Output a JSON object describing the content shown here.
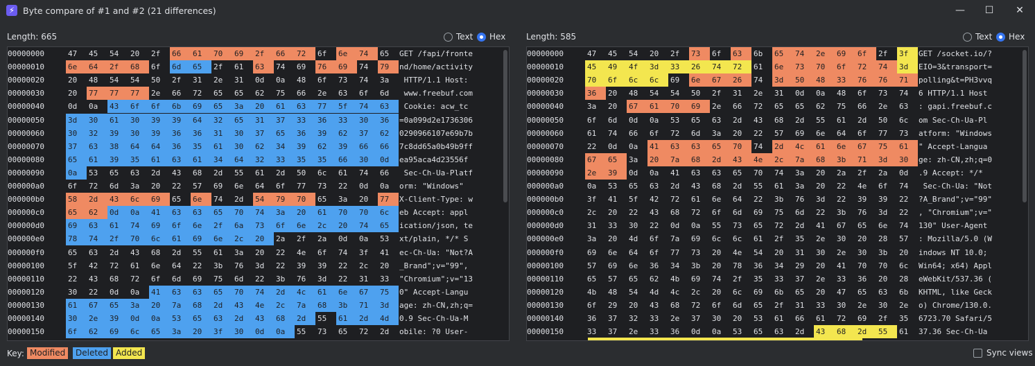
{
  "title": "Byte compare of #1 and #2  (21 differences)",
  "window_controls": {
    "minimize": "—",
    "maximize": "☐",
    "close": "✕"
  },
  "left": {
    "length_label": "Length: 665",
    "mode_text": "Text",
    "mode_hex": "Hex",
    "rows": [
      {
        "off": "00000000",
        "bytes": [
          "47",
          "45",
          "54",
          "20",
          "2f",
          "66",
          "61",
          "70",
          "69",
          "2f",
          "66",
          "72",
          "6f",
          "6e",
          "74",
          "65"
        ],
        "marks": "_____mmmmmmm_mm_",
        "ascii": "GET /fapi/fronte"
      },
      {
        "off": "00000010",
        "bytes": [
          "6e",
          "64",
          "2f",
          "68",
          "6f",
          "6d",
          "65",
          "2f",
          "61",
          "63",
          "74",
          "69",
          "76",
          "69",
          "74",
          "79"
        ],
        "marks": "mmmm_dd__m__mm_m",
        "ascii": "nd/home/activity"
      },
      {
        "off": "00000020",
        "bytes": [
          "20",
          "48",
          "54",
          "54",
          "50",
          "2f",
          "31",
          "2e",
          "31",
          "0d",
          "0a",
          "48",
          "6f",
          "73",
          "74",
          "3a"
        ],
        "marks": "________________",
        "ascii": " HTTP/1.1 Host:"
      },
      {
        "off": "00000030",
        "bytes": [
          "20",
          "77",
          "77",
          "77",
          "2e",
          "66",
          "72",
          "65",
          "65",
          "62",
          "75",
          "66",
          "2e",
          "63",
          "6f",
          "6d"
        ],
        "marks": "_mmm____________",
        "ascii": " www.freebuf.com"
      },
      {
        "off": "00000040",
        "bytes": [
          "0d",
          "0a",
          "43",
          "6f",
          "6f",
          "6b",
          "69",
          "65",
          "3a",
          "20",
          "61",
          "63",
          "77",
          "5f",
          "74",
          "63"
        ],
        "marks": "__dddddddddddddd",
        "ascii": " Cookie: acw_tc"
      },
      {
        "off": "00000050",
        "bytes": [
          "3d",
          "30",
          "61",
          "30",
          "39",
          "39",
          "64",
          "32",
          "65",
          "31",
          "37",
          "33",
          "36",
          "33",
          "30",
          "36"
        ],
        "marks": "dddddddddddddddd",
        "ascii": "=0a099d2e1736306"
      },
      {
        "off": "00000060",
        "bytes": [
          "30",
          "32",
          "39",
          "30",
          "39",
          "36",
          "36",
          "31",
          "30",
          "37",
          "65",
          "36",
          "39",
          "62",
          "37",
          "62"
        ],
        "marks": "dddddddddddddddd",
        "ascii": "0290966107e69b7b"
      },
      {
        "off": "00000070",
        "bytes": [
          "37",
          "63",
          "38",
          "64",
          "64",
          "36",
          "35",
          "61",
          "30",
          "62",
          "34",
          "39",
          "62",
          "39",
          "66",
          "66"
        ],
        "marks": "dddddddddddddddd",
        "ascii": "7c8dd65a0b49b9ff"
      },
      {
        "off": "00000080",
        "bytes": [
          "65",
          "61",
          "39",
          "35",
          "61",
          "63",
          "61",
          "34",
          "64",
          "32",
          "33",
          "35",
          "35",
          "66",
          "30",
          "0d"
        ],
        "marks": "dddddddddddddddd",
        "ascii": "ea95aca4d23556f"
      },
      {
        "off": "00000090",
        "bytes": [
          "0a",
          "53",
          "65",
          "63",
          "2d",
          "43",
          "68",
          "2d",
          "55",
          "61",
          "2d",
          "50",
          "6c",
          "61",
          "74",
          "66"
        ],
        "marks": "d_______________",
        "ascii": " Sec-Ch-Ua-Platf"
      },
      {
        "off": "000000a0",
        "bytes": [
          "6f",
          "72",
          "6d",
          "3a",
          "20",
          "22",
          "57",
          "69",
          "6e",
          "64",
          "6f",
          "77",
          "73",
          "22",
          "0d",
          "0a"
        ],
        "marks": "________________",
        "ascii": "orm: \"Windows\""
      },
      {
        "off": "000000b0",
        "bytes": [
          "58",
          "2d",
          "43",
          "6c",
          "69",
          "65",
          "6e",
          "74",
          "2d",
          "54",
          "79",
          "70",
          "65",
          "3a",
          "20",
          "77"
        ],
        "marks": "mmmmm_m__mmm___m",
        "ascii": "X-Client-Type: w"
      },
      {
        "off": "000000c0",
        "bytes": [
          "65",
          "62",
          "0d",
          "0a",
          "41",
          "63",
          "63",
          "65",
          "70",
          "74",
          "3a",
          "20",
          "61",
          "70",
          "70",
          "6c"
        ],
        "marks": "mmdddddddddddddd",
        "ascii": "eb Accept: appl"
      },
      {
        "off": "000000d0",
        "bytes": [
          "69",
          "63",
          "61",
          "74",
          "69",
          "6f",
          "6e",
          "2f",
          "6a",
          "73",
          "6f",
          "6e",
          "2c",
          "20",
          "74",
          "65"
        ],
        "marks": "dddddddddddddddd",
        "ascii": "ication/json, te"
      },
      {
        "off": "000000e0",
        "bytes": [
          "78",
          "74",
          "2f",
          "70",
          "6c",
          "61",
          "69",
          "6e",
          "2c",
          "20",
          "2a",
          "2f",
          "2a",
          "0d",
          "0a",
          "53"
        ],
        "marks": "dddddddddd______",
        "ascii": "xt/plain, */* S"
      },
      {
        "off": "000000f0",
        "bytes": [
          "65",
          "63",
          "2d",
          "43",
          "68",
          "2d",
          "55",
          "61",
          "3a",
          "20",
          "22",
          "4e",
          "6f",
          "74",
          "3f",
          "41"
        ],
        "marks": "________________",
        "ascii": "ec-Ch-Ua: \"Not?A"
      },
      {
        "off": "00000100",
        "bytes": [
          "5f",
          "42",
          "72",
          "61",
          "6e",
          "64",
          "22",
          "3b",
          "76",
          "3d",
          "22",
          "39",
          "39",
          "22",
          "2c",
          "20"
        ],
        "marks": "________________",
        "ascii": "_Brand\";v=\"99\","
      },
      {
        "off": "00000110",
        "bytes": [
          "22",
          "43",
          "68",
          "72",
          "6f",
          "6d",
          "69",
          "75",
          "6d",
          "22",
          "3b",
          "76",
          "3d",
          "22",
          "31",
          "33"
        ],
        "marks": "________________",
        "ascii": "\"Chromium\";v=\"13"
      },
      {
        "off": "00000120",
        "bytes": [
          "30",
          "22",
          "0d",
          "0a",
          "41",
          "63",
          "63",
          "65",
          "70",
          "74",
          "2d",
          "4c",
          "61",
          "6e",
          "67",
          "75"
        ],
        "marks": "____dddddddddddd",
        "ascii": "0\" Accept-Langu"
      },
      {
        "off": "00000130",
        "bytes": [
          "61",
          "67",
          "65",
          "3a",
          "20",
          "7a",
          "68",
          "2d",
          "43",
          "4e",
          "2c",
          "7a",
          "68",
          "3b",
          "71",
          "3d"
        ],
        "marks": "dddddddddddddddd",
        "ascii": "age: zh-CN,zh;q="
      },
      {
        "off": "00000140",
        "bytes": [
          "30",
          "2e",
          "39",
          "0d",
          "0a",
          "53",
          "65",
          "63",
          "2d",
          "43",
          "68",
          "2d",
          "55",
          "61",
          "2d",
          "4d"
        ],
        "marks": "dddddddddddd_ddd",
        "ascii": "0.9 Sec-Ch-Ua-M"
      },
      {
        "off": "00000150",
        "bytes": [
          "6f",
          "62",
          "69",
          "6c",
          "65",
          "3a",
          "20",
          "3f",
          "30",
          "0d",
          "0a",
          "55",
          "73",
          "65",
          "72",
          "2d"
        ],
        "marks": "ddddddddddd_____",
        "ascii": "obile: ?0 User-"
      }
    ]
  },
  "right": {
    "length_label": "Length: 585",
    "mode_text": "Text",
    "mode_hex": "Hex",
    "rows": [
      {
        "off": "00000000",
        "bytes": [
          "47",
          "45",
          "54",
          "20",
          "2f",
          "73",
          "6f",
          "63",
          "6b",
          "65",
          "74",
          "2e",
          "69",
          "6f",
          "2f",
          "3f"
        ],
        "marks": "_____m_m_mmmmm_a",
        "ascii": "GET /socket.io/?"
      },
      {
        "off": "00000010",
        "bytes": [
          "45",
          "49",
          "4f",
          "3d",
          "33",
          "26",
          "74",
          "72",
          "61",
          "6e",
          "73",
          "70",
          "6f",
          "72",
          "74",
          "3d"
        ],
        "marks": "aaaaaaaa_mmmmmma",
        "ascii": "EIO=3&transport="
      },
      {
        "off": "00000020",
        "bytes": [
          "70",
          "6f",
          "6c",
          "6c",
          "69",
          "6e",
          "67",
          "26",
          "74",
          "3d",
          "50",
          "48",
          "33",
          "76",
          "76",
          "71"
        ],
        "marks": "aaaa_mmm_mmmmmmm",
        "ascii": "polling&t=PH3vvq"
      },
      {
        "off": "00000030",
        "bytes": [
          "36",
          "20",
          "48",
          "54",
          "54",
          "50",
          "2f",
          "31",
          "2e",
          "31",
          "0d",
          "0a",
          "48",
          "6f",
          "73",
          "74"
        ],
        "marks": "m_______________",
        "ascii": "6 HTTP/1.1 Host"
      },
      {
        "off": "00000040",
        "bytes": [
          "3a",
          "20",
          "67",
          "61",
          "70",
          "69",
          "2e",
          "66",
          "72",
          "65",
          "65",
          "62",
          "75",
          "66",
          "2e",
          "63"
        ],
        "marks": "__mmmm__________",
        "ascii": ": gapi.freebuf.c"
      },
      {
        "off": "00000050",
        "bytes": [
          "6f",
          "6d",
          "0d",
          "0a",
          "53",
          "65",
          "63",
          "2d",
          "43",
          "68",
          "2d",
          "55",
          "61",
          "2d",
          "50",
          "6c"
        ],
        "marks": "________________",
        "ascii": "om Sec-Ch-Ua-Pl"
      },
      {
        "off": "00000060",
        "bytes": [
          "61",
          "74",
          "66",
          "6f",
          "72",
          "6d",
          "3a",
          "20",
          "22",
          "57",
          "69",
          "6e",
          "64",
          "6f",
          "77",
          "73"
        ],
        "marks": "________________",
        "ascii": "atform: \"Windows"
      },
      {
        "off": "00000070",
        "bytes": [
          "22",
          "0d",
          "0a",
          "41",
          "63",
          "63",
          "65",
          "70",
          "74",
          "2d",
          "4c",
          "61",
          "6e",
          "67",
          "75",
          "61"
        ],
        "marks": "___mmmmm_mmmmmmm",
        "ascii": "\" Accept-Langua"
      },
      {
        "off": "00000080",
        "bytes": [
          "67",
          "65",
          "3a",
          "20",
          "7a",
          "68",
          "2d",
          "43",
          "4e",
          "2c",
          "7a",
          "68",
          "3b",
          "71",
          "3d",
          "30"
        ],
        "marks": "mm_mmmmmmmmmmmmm",
        "ascii": "ge: zh-CN,zh;q=0"
      },
      {
        "off": "00000090",
        "bytes": [
          "2e",
          "39",
          "0d",
          "0a",
          "41",
          "63",
          "63",
          "65",
          "70",
          "74",
          "3a",
          "20",
          "2a",
          "2f",
          "2a",
          "0d"
        ],
        "marks": "mm______________",
        "ascii": ".9 Accept: */*"
      },
      {
        "off": "000000a0",
        "bytes": [
          "0a",
          "53",
          "65",
          "63",
          "2d",
          "43",
          "68",
          "2d",
          "55",
          "61",
          "3a",
          "20",
          "22",
          "4e",
          "6f",
          "74"
        ],
        "marks": "________________",
        "ascii": " Sec-Ch-Ua: \"Not"
      },
      {
        "off": "000000b0",
        "bytes": [
          "3f",
          "41",
          "5f",
          "42",
          "72",
          "61",
          "6e",
          "64",
          "22",
          "3b",
          "76",
          "3d",
          "22",
          "39",
          "39",
          "22"
        ],
        "marks": "________________",
        "ascii": "?A_Brand\";v=\"99\""
      },
      {
        "off": "000000c0",
        "bytes": [
          "2c",
          "20",
          "22",
          "43",
          "68",
          "72",
          "6f",
          "6d",
          "69",
          "75",
          "6d",
          "22",
          "3b",
          "76",
          "3d",
          "22"
        ],
        "marks": "________________",
        "ascii": ", \"Chromium\";v=\""
      },
      {
        "off": "000000d0",
        "bytes": [
          "31",
          "33",
          "30",
          "22",
          "0d",
          "0a",
          "55",
          "73",
          "65",
          "72",
          "2d",
          "41",
          "67",
          "65",
          "6e",
          "74"
        ],
        "marks": "________________",
        "ascii": "130\" User-Agent"
      },
      {
        "off": "000000e0",
        "bytes": [
          "3a",
          "20",
          "4d",
          "6f",
          "7a",
          "69",
          "6c",
          "6c",
          "61",
          "2f",
          "35",
          "2e",
          "30",
          "20",
          "28",
          "57"
        ],
        "marks": "________________",
        "ascii": ": Mozilla/5.0 (W"
      },
      {
        "off": "000000f0",
        "bytes": [
          "69",
          "6e",
          "64",
          "6f",
          "77",
          "73",
          "20",
          "4e",
          "54",
          "20",
          "31",
          "30",
          "2e",
          "30",
          "3b",
          "20"
        ],
        "marks": "________________",
        "ascii": "indows NT 10.0;"
      },
      {
        "off": "00000100",
        "bytes": [
          "57",
          "69",
          "6e",
          "36",
          "34",
          "3b",
          "20",
          "78",
          "36",
          "34",
          "29",
          "20",
          "41",
          "70",
          "70",
          "6c"
        ],
        "marks": "________________",
        "ascii": "Win64; x64) Appl"
      },
      {
        "off": "00000110",
        "bytes": [
          "65",
          "57",
          "65",
          "62",
          "4b",
          "69",
          "74",
          "2f",
          "35",
          "33",
          "37",
          "2e",
          "33",
          "36",
          "20",
          "28"
        ],
        "marks": "________________",
        "ascii": "eWebKit/537.36 ("
      },
      {
        "off": "00000120",
        "bytes": [
          "4b",
          "48",
          "54",
          "4d",
          "4c",
          "2c",
          "20",
          "6c",
          "69",
          "6b",
          "65",
          "20",
          "47",
          "65",
          "63",
          "6b"
        ],
        "marks": "________________",
        "ascii": "KHTML, like Geck"
      },
      {
        "off": "00000130",
        "bytes": [
          "6f",
          "29",
          "20",
          "43",
          "68",
          "72",
          "6f",
          "6d",
          "65",
          "2f",
          "31",
          "33",
          "30",
          "2e",
          "30",
          "2e"
        ],
        "marks": "________________",
        "ascii": "o) Chrome/130.0."
      },
      {
        "off": "00000140",
        "bytes": [
          "36",
          "37",
          "32",
          "33",
          "2e",
          "37",
          "30",
          "20",
          "53",
          "61",
          "66",
          "61",
          "72",
          "69",
          "2f",
          "35"
        ],
        "marks": "________________",
        "ascii": "6723.70 Safari/5"
      },
      {
        "off": "00000150",
        "bytes": [
          "33",
          "37",
          "2e",
          "33",
          "36",
          "0d",
          "0a",
          "53",
          "65",
          "63",
          "2d",
          "43",
          "68",
          "2d",
          "55",
          "61"
        ],
        "marks": "___________aaaa_",
        "ascii": "37.36 Sec-Ch-Ua"
      }
    ]
  },
  "footer": {
    "key_label": "Key:",
    "modified": "Modified",
    "deleted": "Deleted",
    "added": "Added",
    "sync_views": "Sync views"
  },
  "colors": {
    "modified": "#ef8a62",
    "deleted": "#4ea1ef",
    "added": "#f3e64f",
    "background": "#2b2d30",
    "panel": "#1e1f22"
  }
}
